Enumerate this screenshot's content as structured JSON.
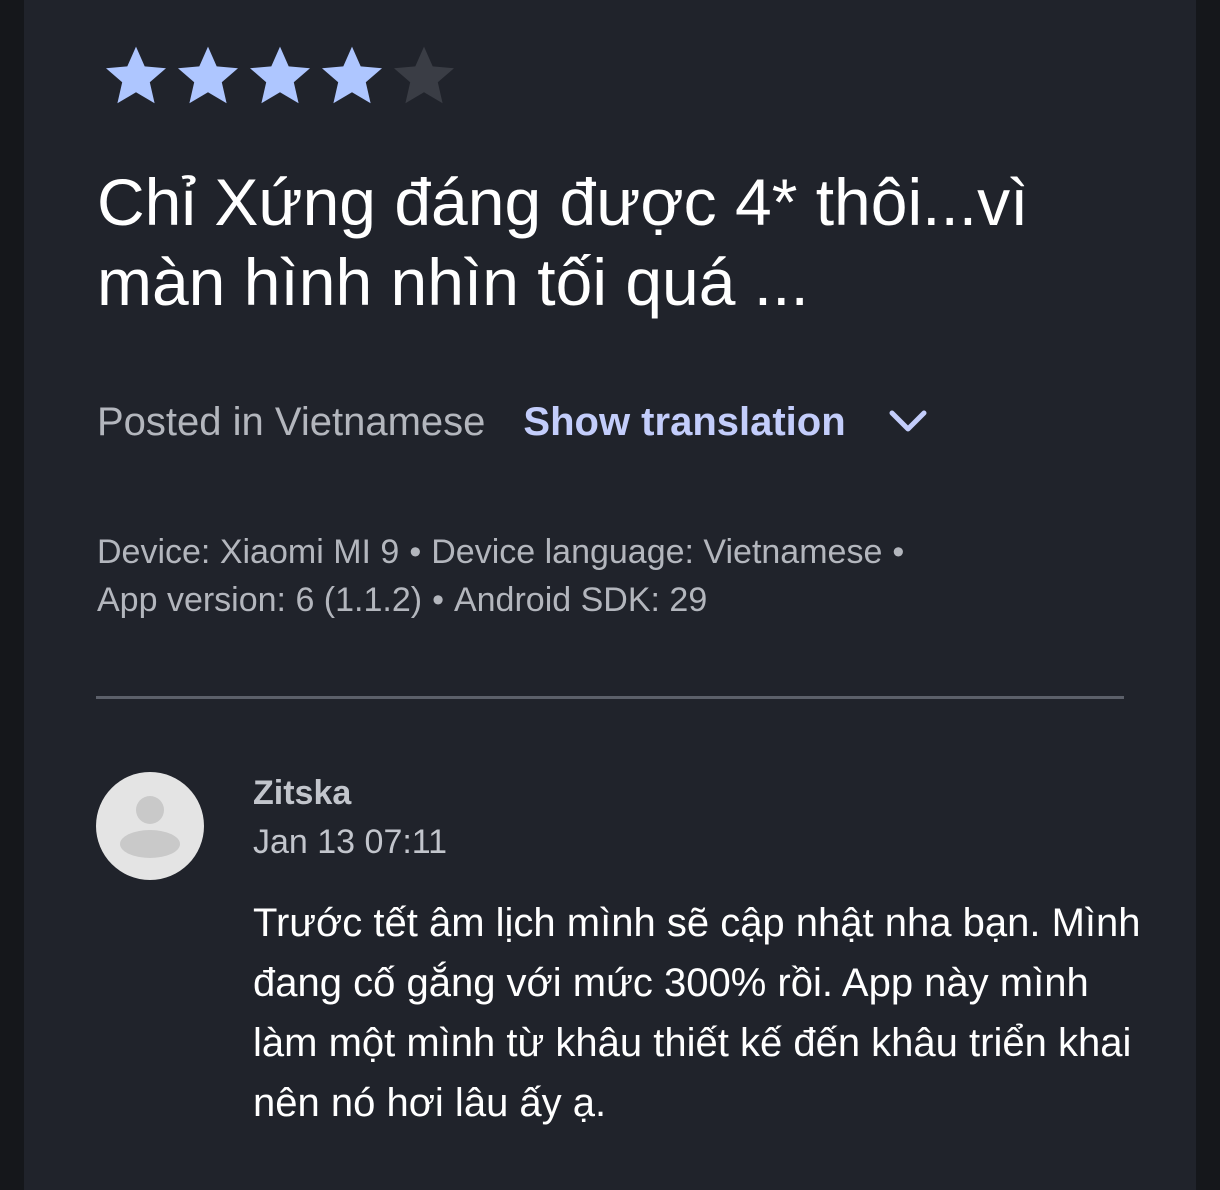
{
  "review": {
    "rating": 4,
    "max_rating": 5,
    "title": "Chỉ Xứng đáng được 4* thôi...vì màn hình nhìn tối quá ...",
    "posted_in": "Posted in Vietnamese",
    "show_translation_label": "Show translation",
    "meta_line1": [
      "Device: Xiaomi MI 9",
      "•",
      "Device language: Vietnamese",
      "•"
    ],
    "meta_line2": [
      "App version: 6 (1.1.2)",
      "•",
      "Android SDK: 29"
    ]
  },
  "reply": {
    "author": "Zitska",
    "date": "Jan 13 07:11",
    "body": "Trước tết âm lịch mình sẽ cập nhật nha bạn. Mình đang cố gắng với mức 300% rồi. App này mình làm một mình từ khâu thiết kế đến khâu triển khai nên nó hơi lâu ấy ạ."
  },
  "icons": {
    "star_filled": "star-icon",
    "star_empty": "star-empty-icon",
    "chevron": "chevron-down-icon",
    "avatar": "avatar-placeholder-icon"
  },
  "colors": {
    "star_filled": "#aec6ff",
    "star_empty": "#3a3d45",
    "accent_link": "#c3cdfb",
    "card_bg": "#20232b",
    "page_bg": "#15171b"
  }
}
